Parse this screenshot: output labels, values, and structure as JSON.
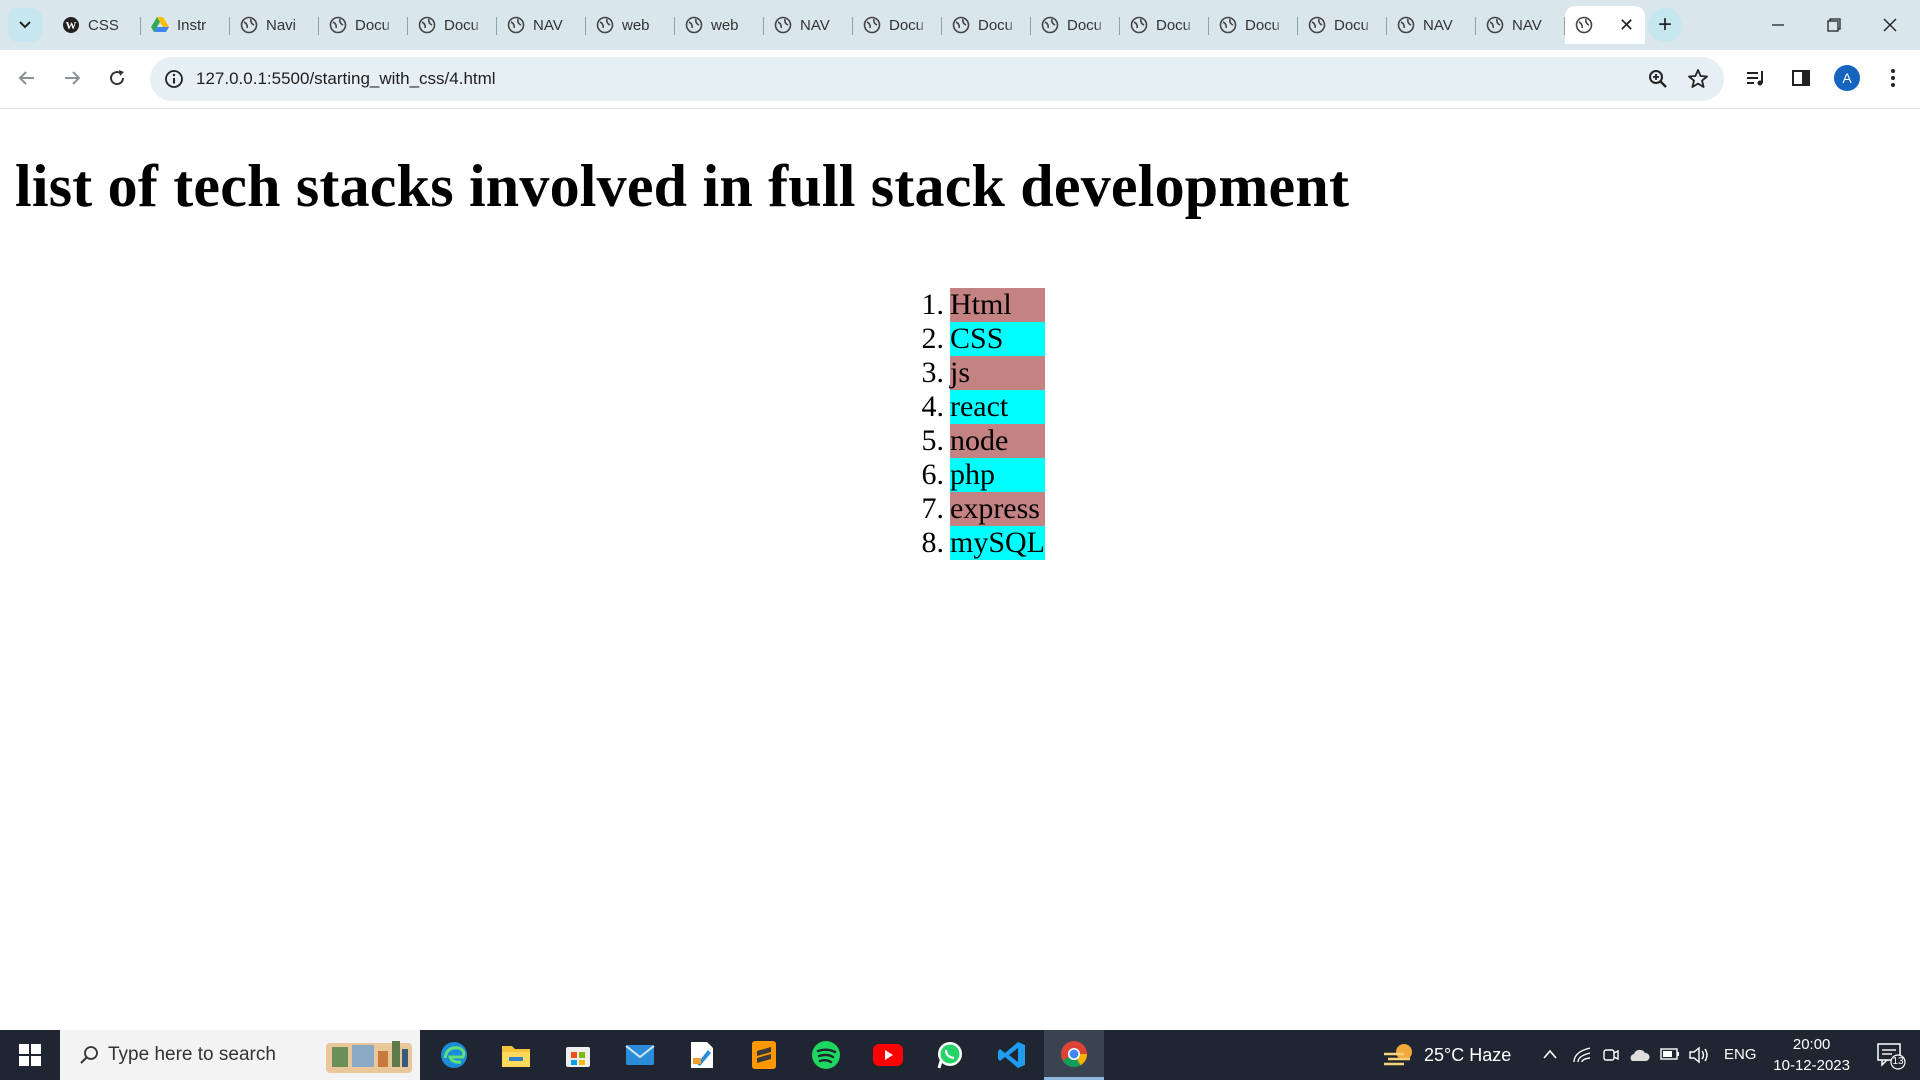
{
  "browser": {
    "tabs": [
      {
        "title": "CSS",
        "icon": "wordpress-icon"
      },
      {
        "title": "Instr",
        "icon": "google-drive-icon"
      },
      {
        "title": "Navi",
        "icon": "globe-icon"
      },
      {
        "title": "Docu",
        "icon": "globe-icon"
      },
      {
        "title": "Docu",
        "icon": "globe-icon"
      },
      {
        "title": "NAV",
        "icon": "globe-icon"
      },
      {
        "title": "web",
        "icon": "globe-icon"
      },
      {
        "title": "web",
        "icon": "globe-icon"
      },
      {
        "title": "NAV",
        "icon": "globe-icon"
      },
      {
        "title": "Docu",
        "icon": "globe-icon"
      },
      {
        "title": "Docu",
        "icon": "globe-icon"
      },
      {
        "title": "Docu",
        "icon": "globe-icon"
      },
      {
        "title": "Docu",
        "icon": "globe-icon"
      },
      {
        "title": "Docu",
        "icon": "globe-icon"
      },
      {
        "title": "Docu",
        "icon": "globe-icon"
      },
      {
        "title": "NAV",
        "icon": "globe-icon"
      },
      {
        "title": "NAV",
        "icon": "globe-icon"
      }
    ],
    "active_tab_close": "✕",
    "new_tab": "+",
    "url": "127.0.0.1:5500/starting_with_css/4.html",
    "profile_initial": "A"
  },
  "page": {
    "heading": "list of tech stacks involved in full stack development",
    "items": [
      {
        "num": "1.",
        "label": "Html"
      },
      {
        "num": "2.",
        "label": "CSS"
      },
      {
        "num": "3.",
        "label": "js"
      },
      {
        "num": "4.",
        "label": "react"
      },
      {
        "num": "5.",
        "label": "node"
      },
      {
        "num": "6.",
        "label": "php"
      },
      {
        "num": "7.",
        "label": "express"
      },
      {
        "num": "8.",
        "label": "mySQL"
      }
    ],
    "colors": {
      "odd_bg": "#c48282",
      "even_bg": "#00ffff"
    }
  },
  "taskbar": {
    "search_placeholder": "Type here to search",
    "weather": "25°C  Haze",
    "language": "ENG",
    "time": "20:00",
    "date": "10-12-2023",
    "notifications_count": "13",
    "apps": [
      "edge-icon",
      "file-explorer-icon",
      "microsoft-store-icon",
      "mail-icon",
      "paint-icon",
      "sublime-text-icon",
      "spotify-icon",
      "youtube-icon",
      "whatsapp-icon",
      "vscode-icon",
      "chrome-icon"
    ]
  }
}
